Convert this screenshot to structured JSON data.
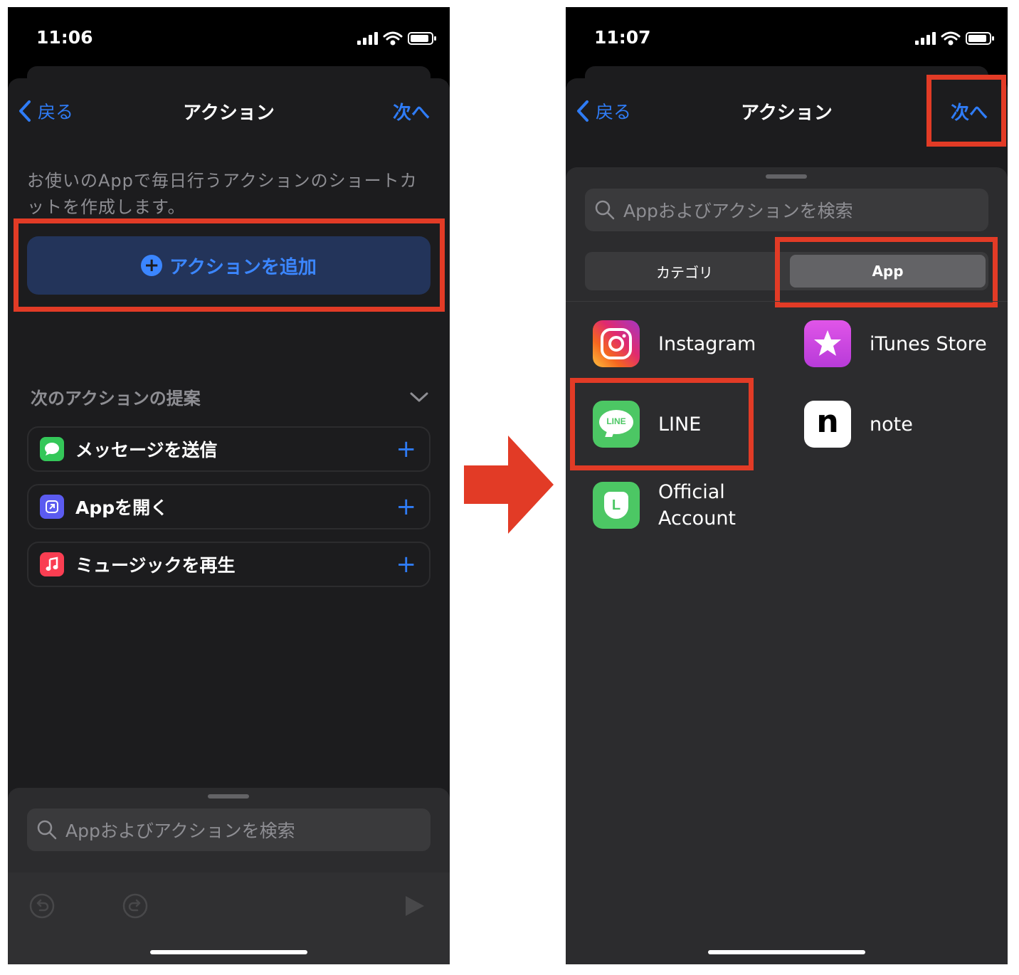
{
  "left": {
    "status": {
      "time": "11:06"
    },
    "nav": {
      "back": "戻る",
      "title": "アクション",
      "next": "次へ"
    },
    "description": "お使いのAppで毎日行うアクションのショートカットを作成します。",
    "add_action": "アクションを追加",
    "suggestions": {
      "heading": "次のアクションの提案",
      "items": [
        {
          "label": "メッセージを送信",
          "icon": "messages-icon",
          "color": "#34c759"
        },
        {
          "label": "Appを開く",
          "icon": "open-app-icon",
          "color": "#5b5bf0"
        },
        {
          "label": "ミュージックを再生",
          "icon": "music-icon",
          "color": "#fa3e52"
        }
      ]
    },
    "search": {
      "placeholder": "Appおよびアクションを検索"
    }
  },
  "right": {
    "status": {
      "time": "11:07"
    },
    "nav": {
      "back": "戻る",
      "title": "アクション",
      "next": "次へ"
    },
    "search": {
      "placeholder": "Appおよびアクションを検索"
    },
    "segments": {
      "category": "カテゴリ",
      "app": "App",
      "selected": "App"
    },
    "apps": [
      {
        "name": "Instagram",
        "icon": "instagram-icon"
      },
      {
        "name": "iTunes Store",
        "icon": "itunes-store-icon"
      },
      {
        "name": "LINE",
        "icon": "line-icon",
        "icon_text": "LINE"
      },
      {
        "name": "note",
        "icon": "note-icon",
        "icon_text": "n"
      },
      {
        "name_line1": "Official",
        "name_line2": "Account",
        "icon": "official-account-icon",
        "icon_text": "L"
      }
    ]
  },
  "colors": {
    "highlight": "#e23b26",
    "accent": "#2f7cf6",
    "line_green": "#4cc764"
  }
}
